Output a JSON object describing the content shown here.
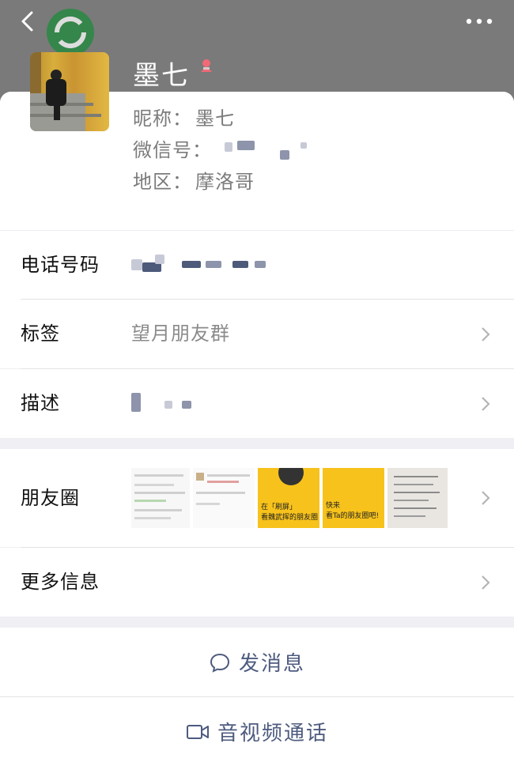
{
  "header": {
    "back_icon": "back-chevron-icon",
    "more_icon": "more-dots-icon",
    "logo_icon": "green-circle-logo"
  },
  "profile": {
    "name": "墨七",
    "gender_icon": "female-icon",
    "nickname_label": "昵称：",
    "nickname_value": "墨七",
    "wechat_id_label": "微信号：",
    "region_label": "地区：",
    "region_value": "摩洛哥"
  },
  "rows": {
    "phone_label": "电话号码",
    "tags_label": "标签",
    "tags_value": "望月朋友群",
    "description_label": "描述",
    "moments_label": "朋友圈",
    "more_info_label": "更多信息"
  },
  "moments_thumbs": {
    "thumb3_line1": "在「刷屏」",
    "thumb3_line2": "看魏武挥的朋友圈",
    "thumb4_line1": "快来",
    "thumb4_line2": "看Ta的朋友圈吧!"
  },
  "actions": {
    "message_label": "发消息",
    "call_label": "音视频通话"
  },
  "colors": {
    "link_blue": "#4e5b7f",
    "header_gray": "#7a7a7a",
    "thumb_yellow": "#f7c21b"
  }
}
